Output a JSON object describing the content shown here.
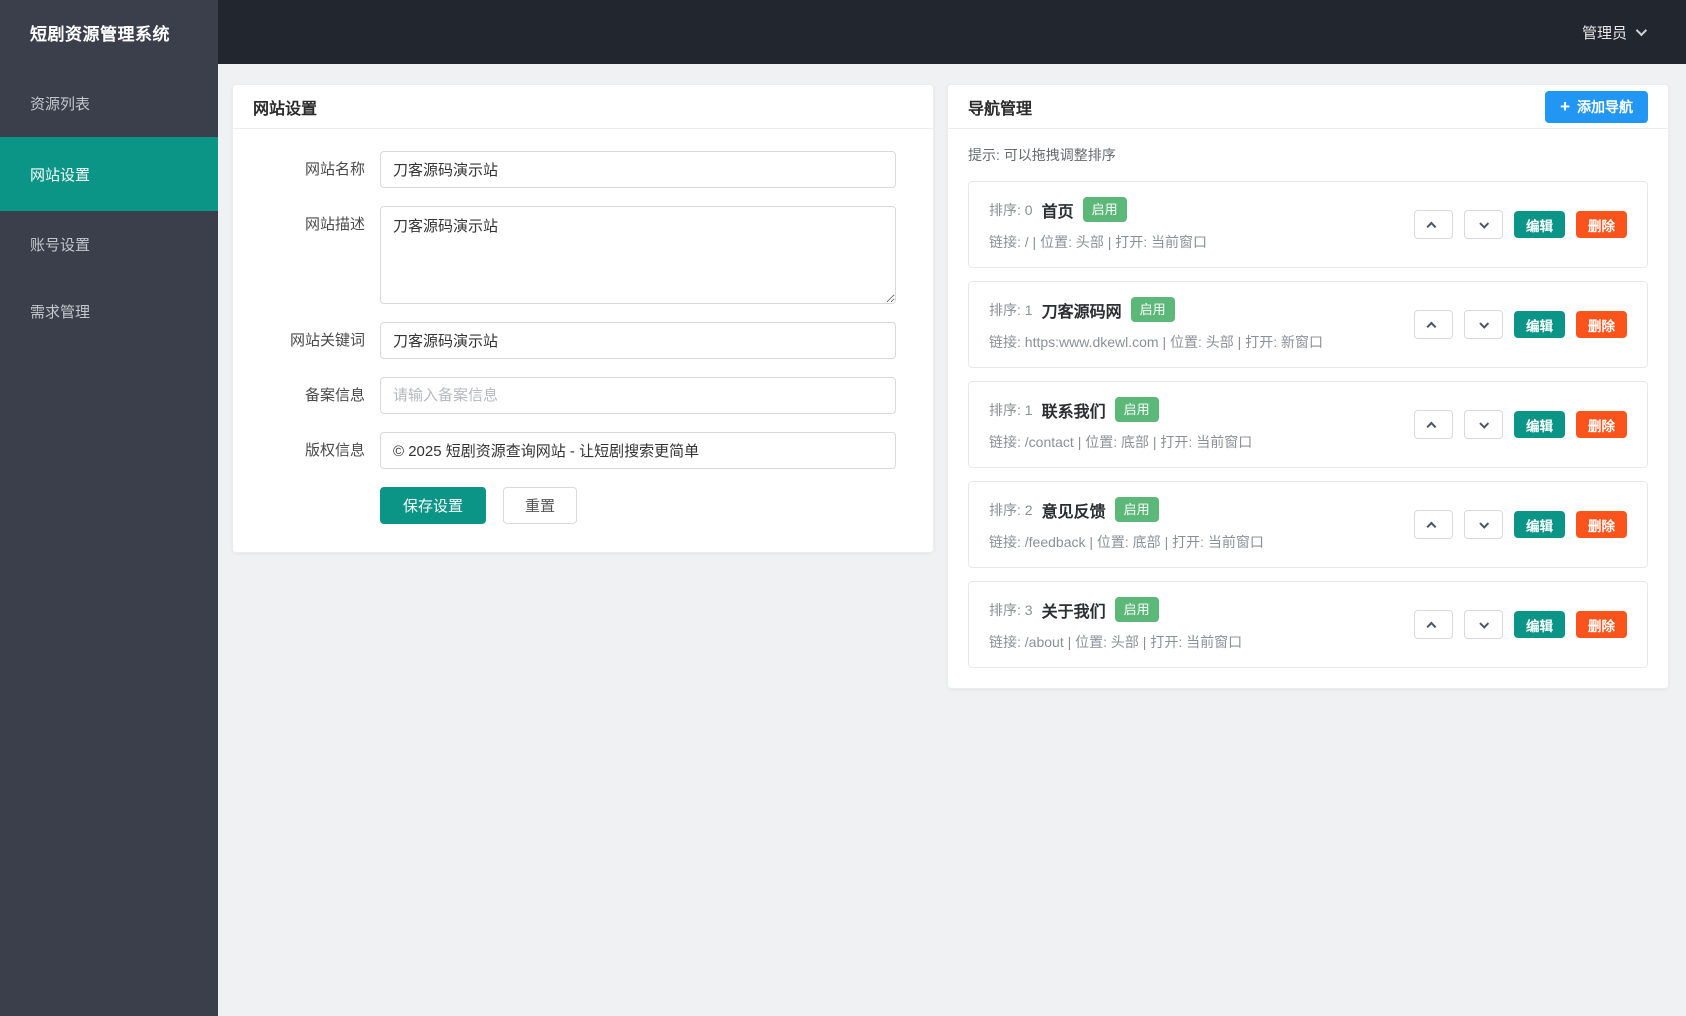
{
  "app": {
    "title": "短剧资源管理系统",
    "user": "管理员"
  },
  "sidebar": {
    "items": [
      {
        "label": "资源列表"
      },
      {
        "label": "网站设置"
      },
      {
        "label": "账号设置"
      },
      {
        "label": "需求管理"
      }
    ]
  },
  "site": {
    "title": "网站设置",
    "fields": [
      {
        "label": "网站名称",
        "value": "刀客源码演示站"
      },
      {
        "label": "网站描述",
        "value": "刀客源码演示站"
      },
      {
        "label": "网站关键词",
        "value": "刀客源码演示站"
      },
      {
        "label": "备案信息",
        "placeholder": "请输入备案信息"
      },
      {
        "label": "版权信息",
        "value": "© 2025 短剧资源查询网站 - 让短剧搜索更简单"
      }
    ],
    "save_label": "保存设置",
    "reset_label": "重置"
  },
  "nav": {
    "title": "导航管理",
    "add_label": "添加导航",
    "plus_icon": "+",
    "hint": "提示: 可以拖拽调整排序",
    "edit_label": "编辑",
    "delete_label": "删除",
    "items": [
      {
        "sort": "排序: 0",
        "name": "首页",
        "status": "启用",
        "meta": "链接: / | 位置: 头部 | 打开: 当前窗口"
      },
      {
        "sort": "排序: 1",
        "name": "刀客源码网",
        "status": "启用",
        "meta": "链接: https:www.dkewl.com | 位置: 头部 | 打开: 新窗口"
      },
      {
        "sort": "排序: 1",
        "name": "联系我们",
        "status": "启用",
        "meta": "链接: /contact | 位置: 底部 | 打开: 当前窗口"
      },
      {
        "sort": "排序: 2",
        "name": "意见反馈",
        "status": "启用",
        "meta": "链接: /feedback | 位置: 底部 | 打开: 当前窗口"
      },
      {
        "sort": "排序: 3",
        "name": "关于我们",
        "status": "启用",
        "meta": "链接: /about | 位置: 头部 | 打开: 当前窗口"
      }
    ]
  },
  "colors": {
    "sidebar_bg": "#3a3f4b",
    "topbar_bg": "#22262e",
    "accent_teal": "#0b9586",
    "status_green": "#5cb878",
    "delete_orange": "#fa541c",
    "add_blue": "#2196f3",
    "page_bg": "#f0f1f2"
  }
}
